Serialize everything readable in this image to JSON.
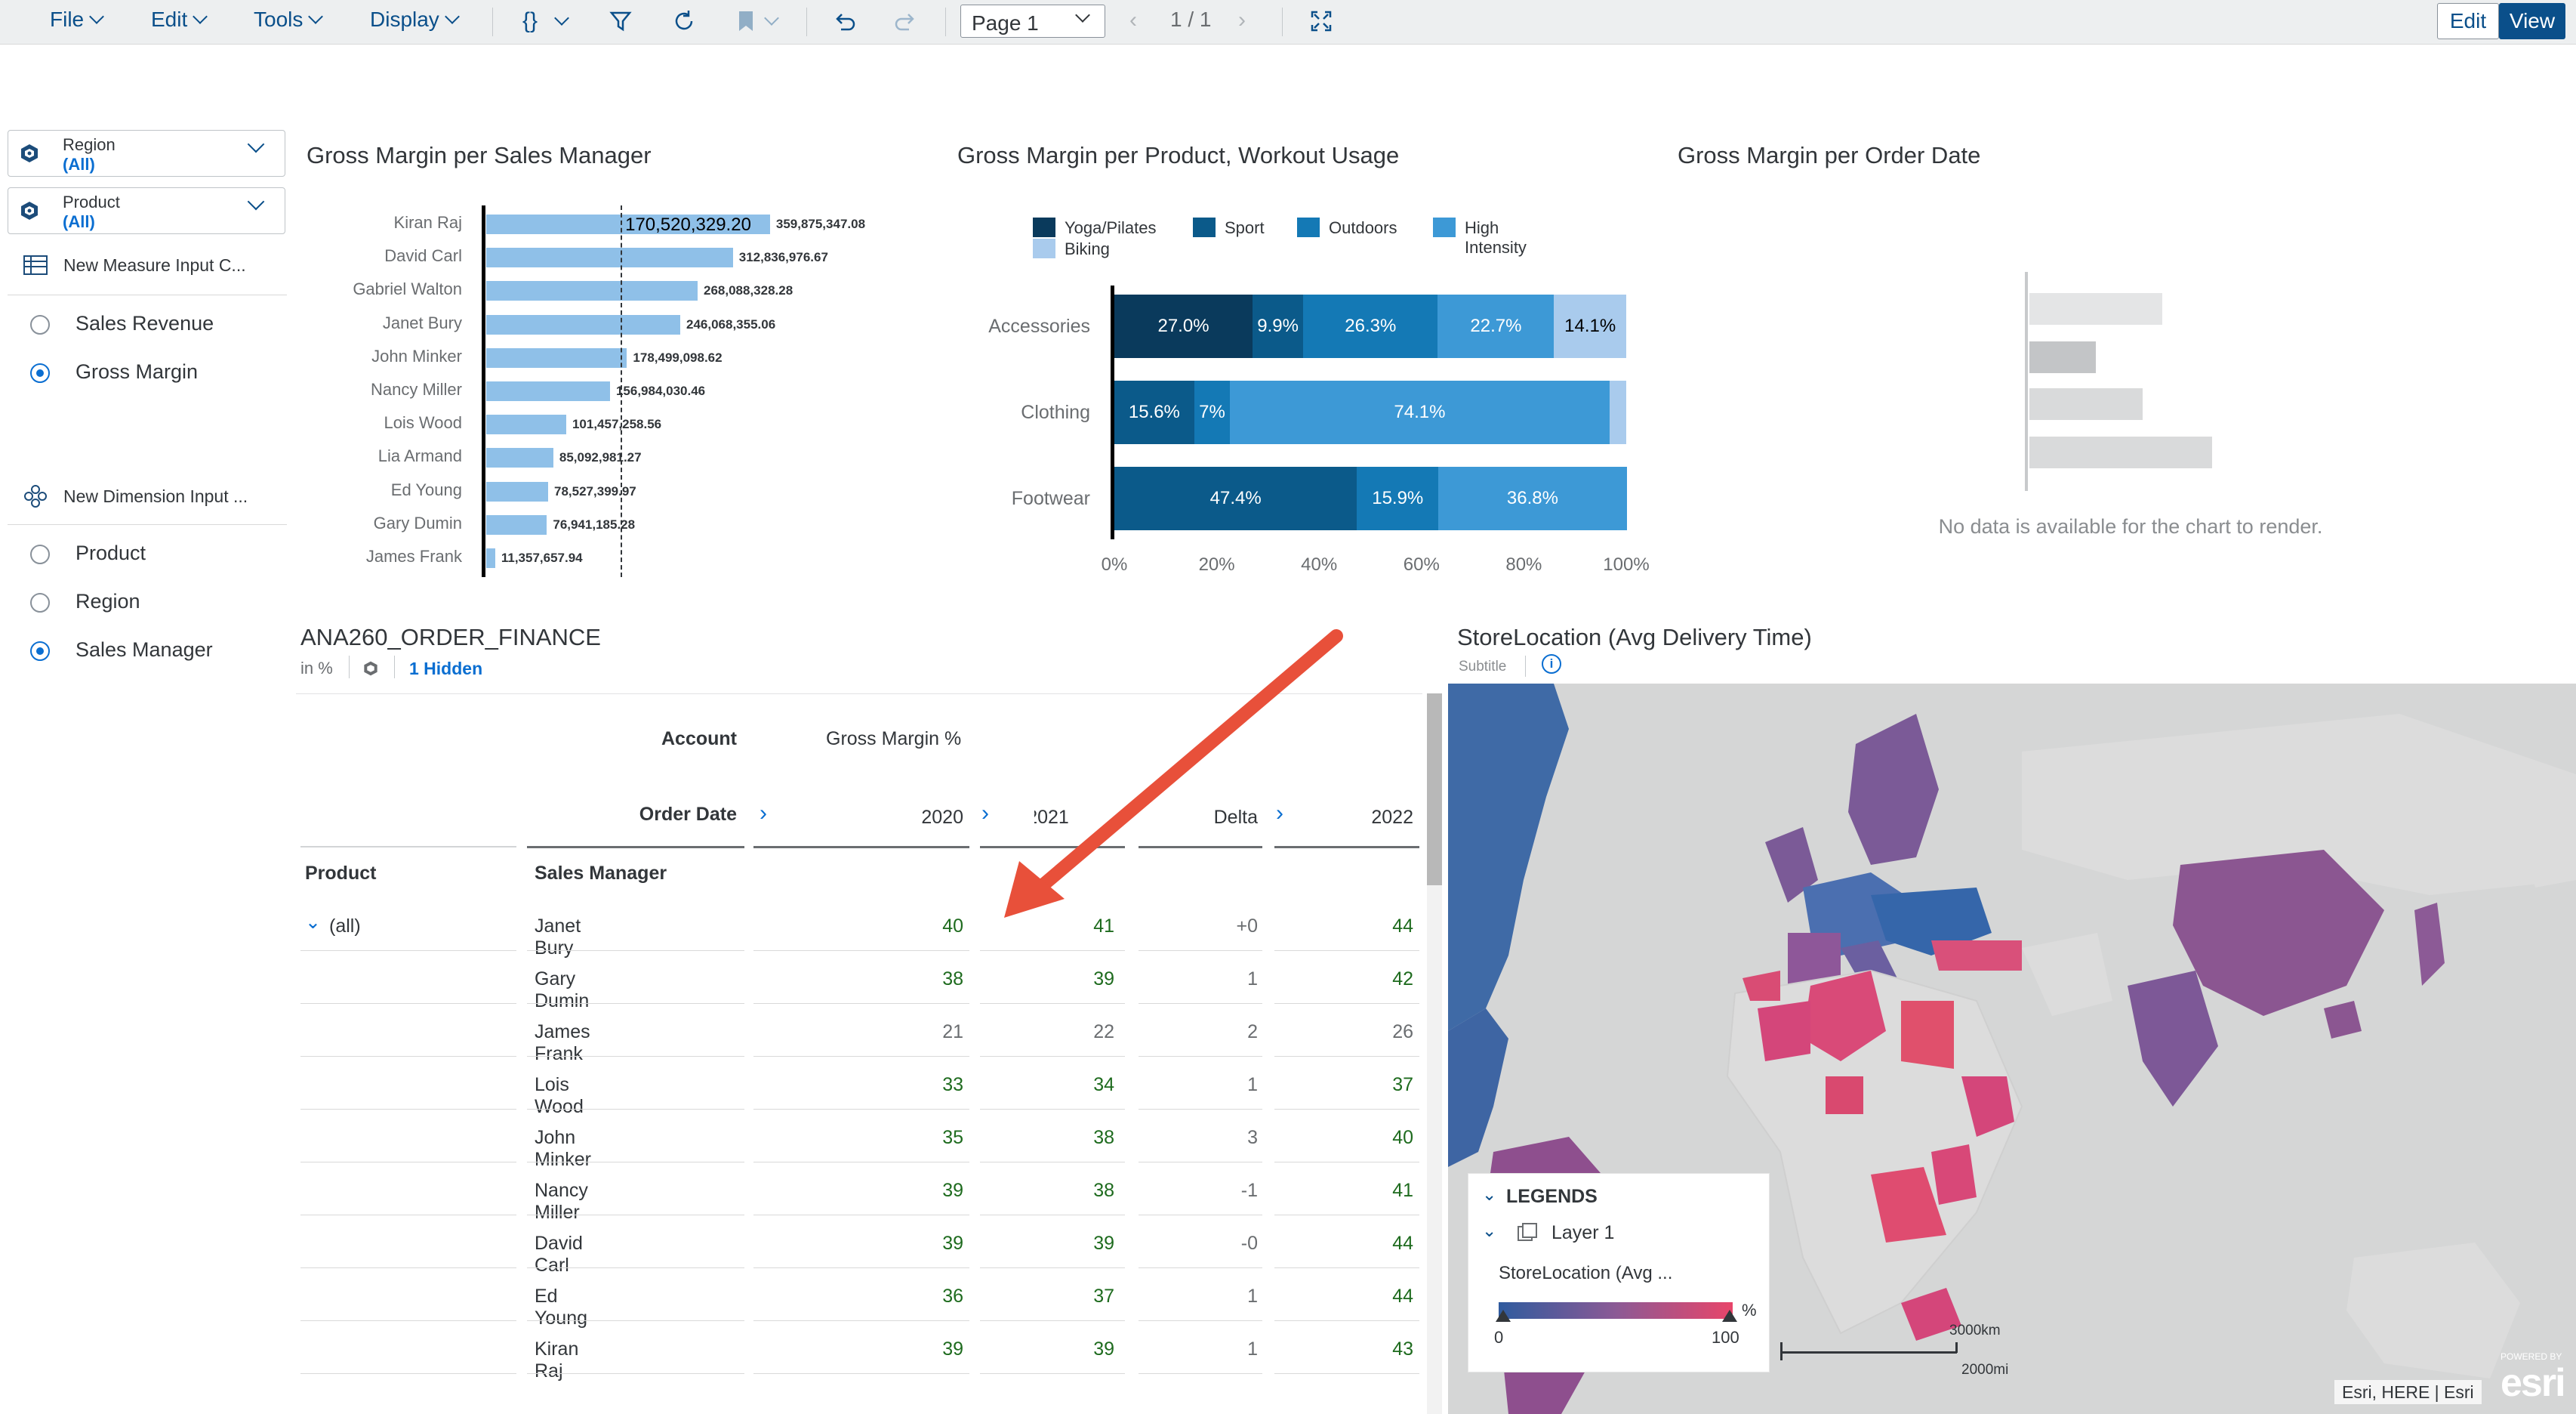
{
  "toolbar": {
    "menus": [
      "File",
      "Edit",
      "Tools",
      "Display"
    ],
    "page_select": "Page 1",
    "page_nav": "1 / 1",
    "edit_label": "Edit",
    "view_label": "View"
  },
  "left_panel": {
    "filters": [
      {
        "name": "Region",
        "value": "(All)"
      },
      {
        "name": "Product",
        "value": "(All)"
      }
    ],
    "measure_input": {
      "title": "New Measure Input C...",
      "options": [
        {
          "label": "Sales Revenue",
          "selected": false
        },
        {
          "label": "Gross Margin",
          "selected": true
        }
      ]
    },
    "dimension_input": {
      "title": "New Dimension Input ...",
      "options": [
        {
          "label": "Product",
          "selected": false
        },
        {
          "label": "Region",
          "selected": false
        },
        {
          "label": "Sales Manager",
          "selected": true
        }
      ]
    }
  },
  "chart1": {
    "title": "Gross Margin per Sales Manager",
    "reference_label": "170,520,329.20",
    "chart_data": {
      "type": "bar",
      "orientation": "horizontal",
      "title": "Gross Margin per Sales Manager",
      "categories": [
        "Kiran Raj",
        "David Carl",
        "Gabriel Walton",
        "Janet Bury",
        "John Minker",
        "Nancy Miller",
        "Lois Wood",
        "Lia Armand",
        "Ed Young",
        "Gary Dumin",
        "James Frank"
      ],
      "values": [
        359875347.08,
        312836976.67,
        268088328.28,
        246068355.06,
        178499098.62,
        156984030.46,
        101457258.56,
        85092981.27,
        78527399.97,
        76941185.28,
        11357657.94
      ],
      "value_labels": [
        "359,875,347.08",
        "312,836,976.67",
        "268,088,328.28",
        "246,068,355.06",
        "178,499,098.62",
        "156,984,030.46",
        "101,457,258.56",
        "85,092,981.27",
        "78,527,399.97",
        "76,941,185.28",
        "11,357,657.94"
      ],
      "reference_line": 170520329.2,
      "xlim": [
        0,
        400000000
      ],
      "bar_color": "#8fc0e8"
    }
  },
  "chart2": {
    "title": "Gross Margin per Product, Workout Usage",
    "chart_data": {
      "type": "bar",
      "orientation": "horizontal-stacked-100",
      "title": "Gross Margin per Product, Workout Usage",
      "categories": [
        "Accessories",
        "Clothing",
        "Footwear"
      ],
      "series": [
        {
          "name": "Yoga/Pilates",
          "color": "#0a3a5c",
          "values": [
            27.0,
            0,
            0
          ],
          "labels": [
            "27.0%",
            "",
            ""
          ]
        },
        {
          "name": "Sport",
          "color": "#0b5a8a",
          "values": [
            9.9,
            15.6,
            47.4
          ],
          "labels": [
            "9.9%",
            "15.6%",
            "47.4%"
          ]
        },
        {
          "name": "Outdoors",
          "color": "#1479b5",
          "values": [
            26.3,
            7.0,
            15.9
          ],
          "labels": [
            "26.3%",
            "7%",
            "15.9%"
          ]
        },
        {
          "name": "High Intensity",
          "color": "#3d99d6",
          "values": [
            22.7,
            74.1,
            36.8
          ],
          "labels": [
            "22.7%",
            "74.1%",
            "36.8%"
          ]
        },
        {
          "name": "Biking",
          "color": "#a9cbed",
          "values": [
            14.1,
            3.3,
            0
          ],
          "labels": [
            "14.1%",
            "",
            ""
          ]
        }
      ],
      "x_ticks": [
        "0%",
        "20%",
        "40%",
        "60%",
        "80%",
        "100%"
      ],
      "xlim": [
        0,
        100
      ]
    }
  },
  "chart3": {
    "title": "Gross Margin per Order Date",
    "no_data": "No data is available for the chart to render."
  },
  "table": {
    "title": "ANA260_ORDER_FINANCE",
    "unit": "in %",
    "hidden": "1 Hidden",
    "account_label": "Account",
    "account_value": "Gross Margin %",
    "order_date_label": "Order Date",
    "columns": [
      "2020",
      "2021",
      "Delta",
      "2022"
    ],
    "col_product": "Product",
    "col_manager": "Sales Manager",
    "all_label": "(all)",
    "rows": [
      {
        "manager": "Janet Bury",
        "v2020": "40",
        "v2021": "41",
        "delta": "+0",
        "v2022": "44",
        "green": true
      },
      {
        "manager": "Gary Dumin",
        "v2020": "38",
        "v2021": "39",
        "delta": "1",
        "v2022": "42",
        "green": true
      },
      {
        "manager": "James Frank",
        "v2020": "21",
        "v2021": "22",
        "delta": "2",
        "v2022": "26",
        "green": false
      },
      {
        "manager": "Lois Wood",
        "v2020": "33",
        "v2021": "34",
        "delta": "1",
        "v2022": "37",
        "green": true
      },
      {
        "manager": "John Minker",
        "v2020": "35",
        "v2021": "38",
        "delta": "3",
        "v2022": "40",
        "green": true
      },
      {
        "manager": "Nancy Miller",
        "v2020": "39",
        "v2021": "38",
        "delta": "-1",
        "v2022": "41",
        "green": true
      },
      {
        "manager": "David Carl",
        "v2020": "39",
        "v2021": "39",
        "delta": "-0",
        "v2022": "44",
        "green": true
      },
      {
        "manager": "Ed Young",
        "v2020": "36",
        "v2021": "37",
        "delta": "1",
        "v2022": "44",
        "green": true
      },
      {
        "manager": "Kiran Raj",
        "v2020": "39",
        "v2021": "39",
        "delta": "1",
        "v2022": "43",
        "green": true
      }
    ]
  },
  "map": {
    "title": "StoreLocation (Avg Delivery Time)",
    "subtitle": "Subtitle",
    "legends_label": "LEGENDS",
    "layer_label": "Layer 1",
    "legend_measure": "StoreLocation (Avg ...",
    "legend_min": "0",
    "legend_max": "100",
    "legend_unit": "%",
    "scale_km": "3000km",
    "scale_mi": "2000mi",
    "attribution": "Esri, HERE | Esri",
    "powered": "POWERED BY",
    "esri": "esri",
    "gradient_start": "#2f5b9e",
    "gradient_end": "#e8456a"
  }
}
